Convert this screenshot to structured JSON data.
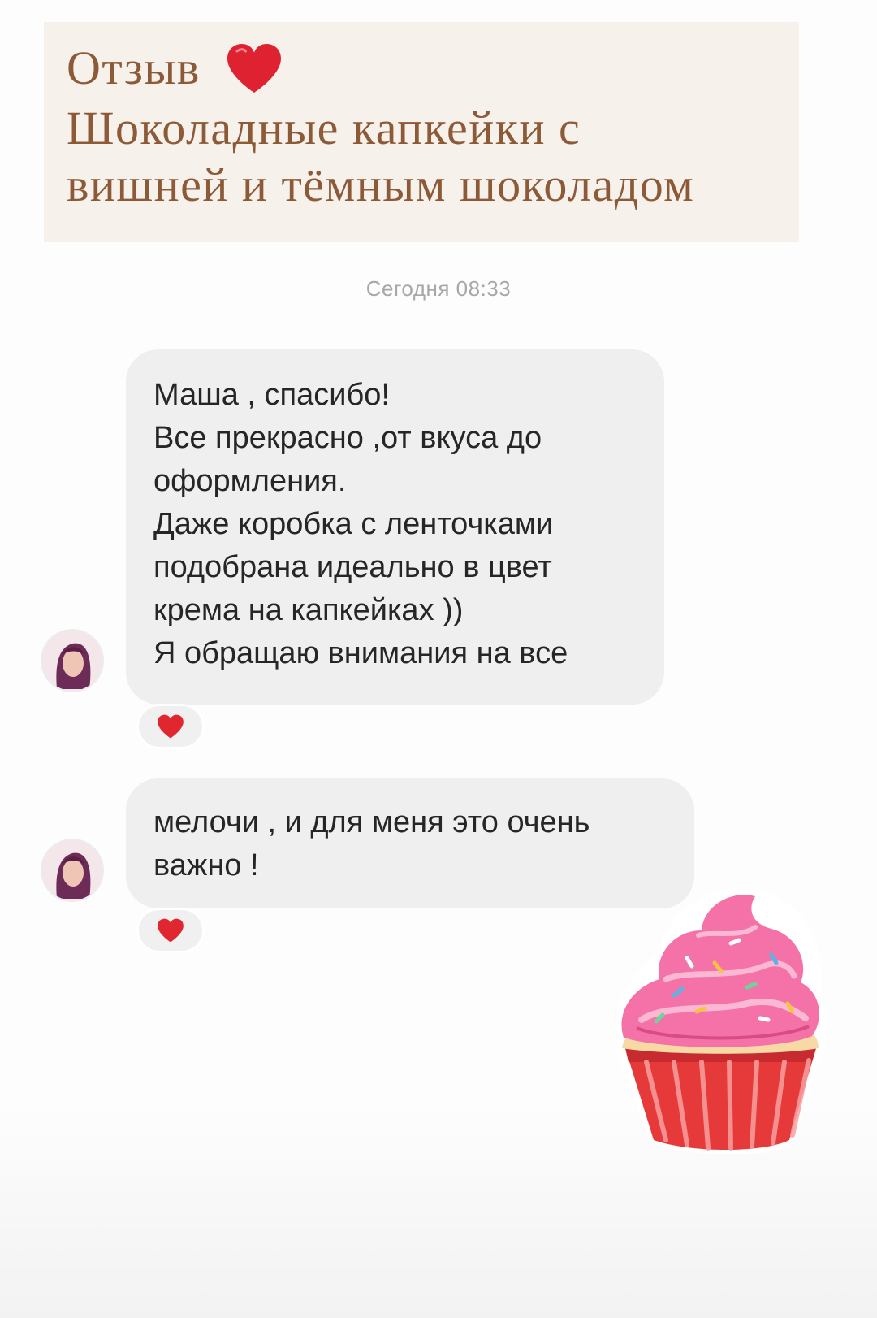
{
  "header": {
    "line1": "Отзыв",
    "line2": "Шоколадные капкейки с",
    "line3": "вишней и тёмным шоколадом",
    "heart_icon": "heart-icon",
    "text_color": "#8c5a37",
    "background": "#f7f1ec"
  },
  "chat": {
    "timestamp": "Сегодня 08:33",
    "messages": [
      {
        "lines": [
          "Маша , спасибо!",
          "Все прекрасно ,от вкуса до",
          "оформления.",
          "Даже коробка с ленточками",
          "подобрана идеально в цвет",
          "крема на капкейках ))",
          "Я обращаю внимания на все"
        ],
        "reaction": "heart-icon"
      },
      {
        "lines": [
          "мелочи , и для меня это очень",
          "важно !"
        ],
        "reaction": "heart-icon"
      }
    ],
    "bubble_color": "#efefef",
    "reaction_color": "#e0262f"
  },
  "sticker": {
    "icon": "cupcake-icon",
    "frosting_color": "#f472a8",
    "wrapper_color": "#e63a3a"
  }
}
